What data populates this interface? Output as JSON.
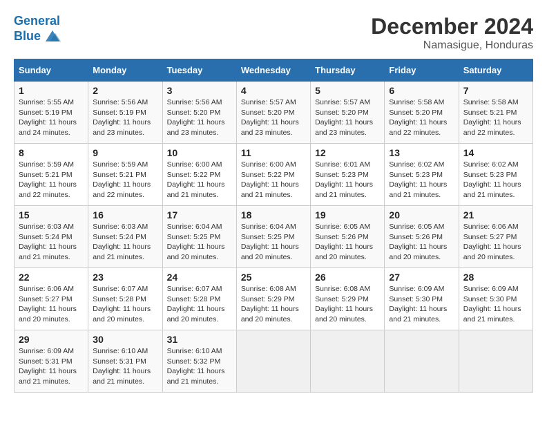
{
  "header": {
    "logo_line1": "General",
    "logo_line2": "Blue",
    "month_year": "December 2024",
    "location": "Namasigue, Honduras"
  },
  "days_of_week": [
    "Sunday",
    "Monday",
    "Tuesday",
    "Wednesday",
    "Thursday",
    "Friday",
    "Saturday"
  ],
  "weeks": [
    [
      {
        "day": "1",
        "info": "Sunrise: 5:55 AM\nSunset: 5:19 PM\nDaylight: 11 hours\nand 24 minutes."
      },
      {
        "day": "2",
        "info": "Sunrise: 5:56 AM\nSunset: 5:19 PM\nDaylight: 11 hours\nand 23 minutes."
      },
      {
        "day": "3",
        "info": "Sunrise: 5:56 AM\nSunset: 5:20 PM\nDaylight: 11 hours\nand 23 minutes."
      },
      {
        "day": "4",
        "info": "Sunrise: 5:57 AM\nSunset: 5:20 PM\nDaylight: 11 hours\nand 23 minutes."
      },
      {
        "day": "5",
        "info": "Sunrise: 5:57 AM\nSunset: 5:20 PM\nDaylight: 11 hours\nand 23 minutes."
      },
      {
        "day": "6",
        "info": "Sunrise: 5:58 AM\nSunset: 5:20 PM\nDaylight: 11 hours\nand 22 minutes."
      },
      {
        "day": "7",
        "info": "Sunrise: 5:58 AM\nSunset: 5:21 PM\nDaylight: 11 hours\nand 22 minutes."
      }
    ],
    [
      {
        "day": "8",
        "info": "Sunrise: 5:59 AM\nSunset: 5:21 PM\nDaylight: 11 hours\nand 22 minutes."
      },
      {
        "day": "9",
        "info": "Sunrise: 5:59 AM\nSunset: 5:21 PM\nDaylight: 11 hours\nand 22 minutes."
      },
      {
        "day": "10",
        "info": "Sunrise: 6:00 AM\nSunset: 5:22 PM\nDaylight: 11 hours\nand 21 minutes."
      },
      {
        "day": "11",
        "info": "Sunrise: 6:00 AM\nSunset: 5:22 PM\nDaylight: 11 hours\nand 21 minutes."
      },
      {
        "day": "12",
        "info": "Sunrise: 6:01 AM\nSunset: 5:23 PM\nDaylight: 11 hours\nand 21 minutes."
      },
      {
        "day": "13",
        "info": "Sunrise: 6:02 AM\nSunset: 5:23 PM\nDaylight: 11 hours\nand 21 minutes."
      },
      {
        "day": "14",
        "info": "Sunrise: 6:02 AM\nSunset: 5:23 PM\nDaylight: 11 hours\nand 21 minutes."
      }
    ],
    [
      {
        "day": "15",
        "info": "Sunrise: 6:03 AM\nSunset: 5:24 PM\nDaylight: 11 hours\nand 21 minutes."
      },
      {
        "day": "16",
        "info": "Sunrise: 6:03 AM\nSunset: 5:24 PM\nDaylight: 11 hours\nand 21 minutes."
      },
      {
        "day": "17",
        "info": "Sunrise: 6:04 AM\nSunset: 5:25 PM\nDaylight: 11 hours\nand 20 minutes."
      },
      {
        "day": "18",
        "info": "Sunrise: 6:04 AM\nSunset: 5:25 PM\nDaylight: 11 hours\nand 20 minutes."
      },
      {
        "day": "19",
        "info": "Sunrise: 6:05 AM\nSunset: 5:26 PM\nDaylight: 11 hours\nand 20 minutes."
      },
      {
        "day": "20",
        "info": "Sunrise: 6:05 AM\nSunset: 5:26 PM\nDaylight: 11 hours\nand 20 minutes."
      },
      {
        "day": "21",
        "info": "Sunrise: 6:06 AM\nSunset: 5:27 PM\nDaylight: 11 hours\nand 20 minutes."
      }
    ],
    [
      {
        "day": "22",
        "info": "Sunrise: 6:06 AM\nSunset: 5:27 PM\nDaylight: 11 hours\nand 20 minutes."
      },
      {
        "day": "23",
        "info": "Sunrise: 6:07 AM\nSunset: 5:28 PM\nDaylight: 11 hours\nand 20 minutes."
      },
      {
        "day": "24",
        "info": "Sunrise: 6:07 AM\nSunset: 5:28 PM\nDaylight: 11 hours\nand 20 minutes."
      },
      {
        "day": "25",
        "info": "Sunrise: 6:08 AM\nSunset: 5:29 PM\nDaylight: 11 hours\nand 20 minutes."
      },
      {
        "day": "26",
        "info": "Sunrise: 6:08 AM\nSunset: 5:29 PM\nDaylight: 11 hours\nand 20 minutes."
      },
      {
        "day": "27",
        "info": "Sunrise: 6:09 AM\nSunset: 5:30 PM\nDaylight: 11 hours\nand 21 minutes."
      },
      {
        "day": "28",
        "info": "Sunrise: 6:09 AM\nSunset: 5:30 PM\nDaylight: 11 hours\nand 21 minutes."
      }
    ],
    [
      {
        "day": "29",
        "info": "Sunrise: 6:09 AM\nSunset: 5:31 PM\nDaylight: 11 hours\nand 21 minutes."
      },
      {
        "day": "30",
        "info": "Sunrise: 6:10 AM\nSunset: 5:31 PM\nDaylight: 11 hours\nand 21 minutes."
      },
      {
        "day": "31",
        "info": "Sunrise: 6:10 AM\nSunset: 5:32 PM\nDaylight: 11 hours\nand 21 minutes."
      },
      {
        "day": "",
        "info": ""
      },
      {
        "day": "",
        "info": ""
      },
      {
        "day": "",
        "info": ""
      },
      {
        "day": "",
        "info": ""
      }
    ]
  ]
}
